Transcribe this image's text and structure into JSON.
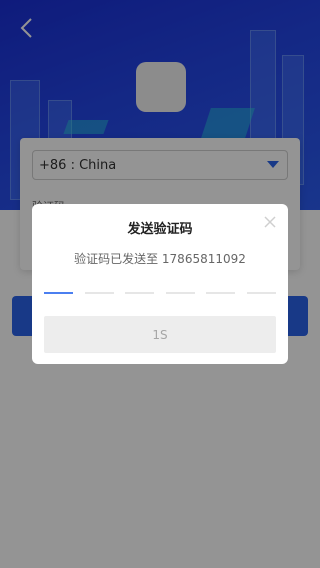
{
  "login": {
    "country_code": "+86 : China",
    "code_label": "验证码"
  },
  "dialog": {
    "title": "发送验证码",
    "sent_message": "验证码已发送至 17865811092",
    "code_length": 6,
    "countdown_label": "1S"
  },
  "icons": {
    "back": "back-arrow-icon",
    "close": "close-icon",
    "dropdown": "caret-down-icon"
  },
  "colors": {
    "accent": "#2a63e8",
    "hero_bg": "#1f3ddc",
    "overlay": "rgba(0,0,0,0.42)"
  }
}
